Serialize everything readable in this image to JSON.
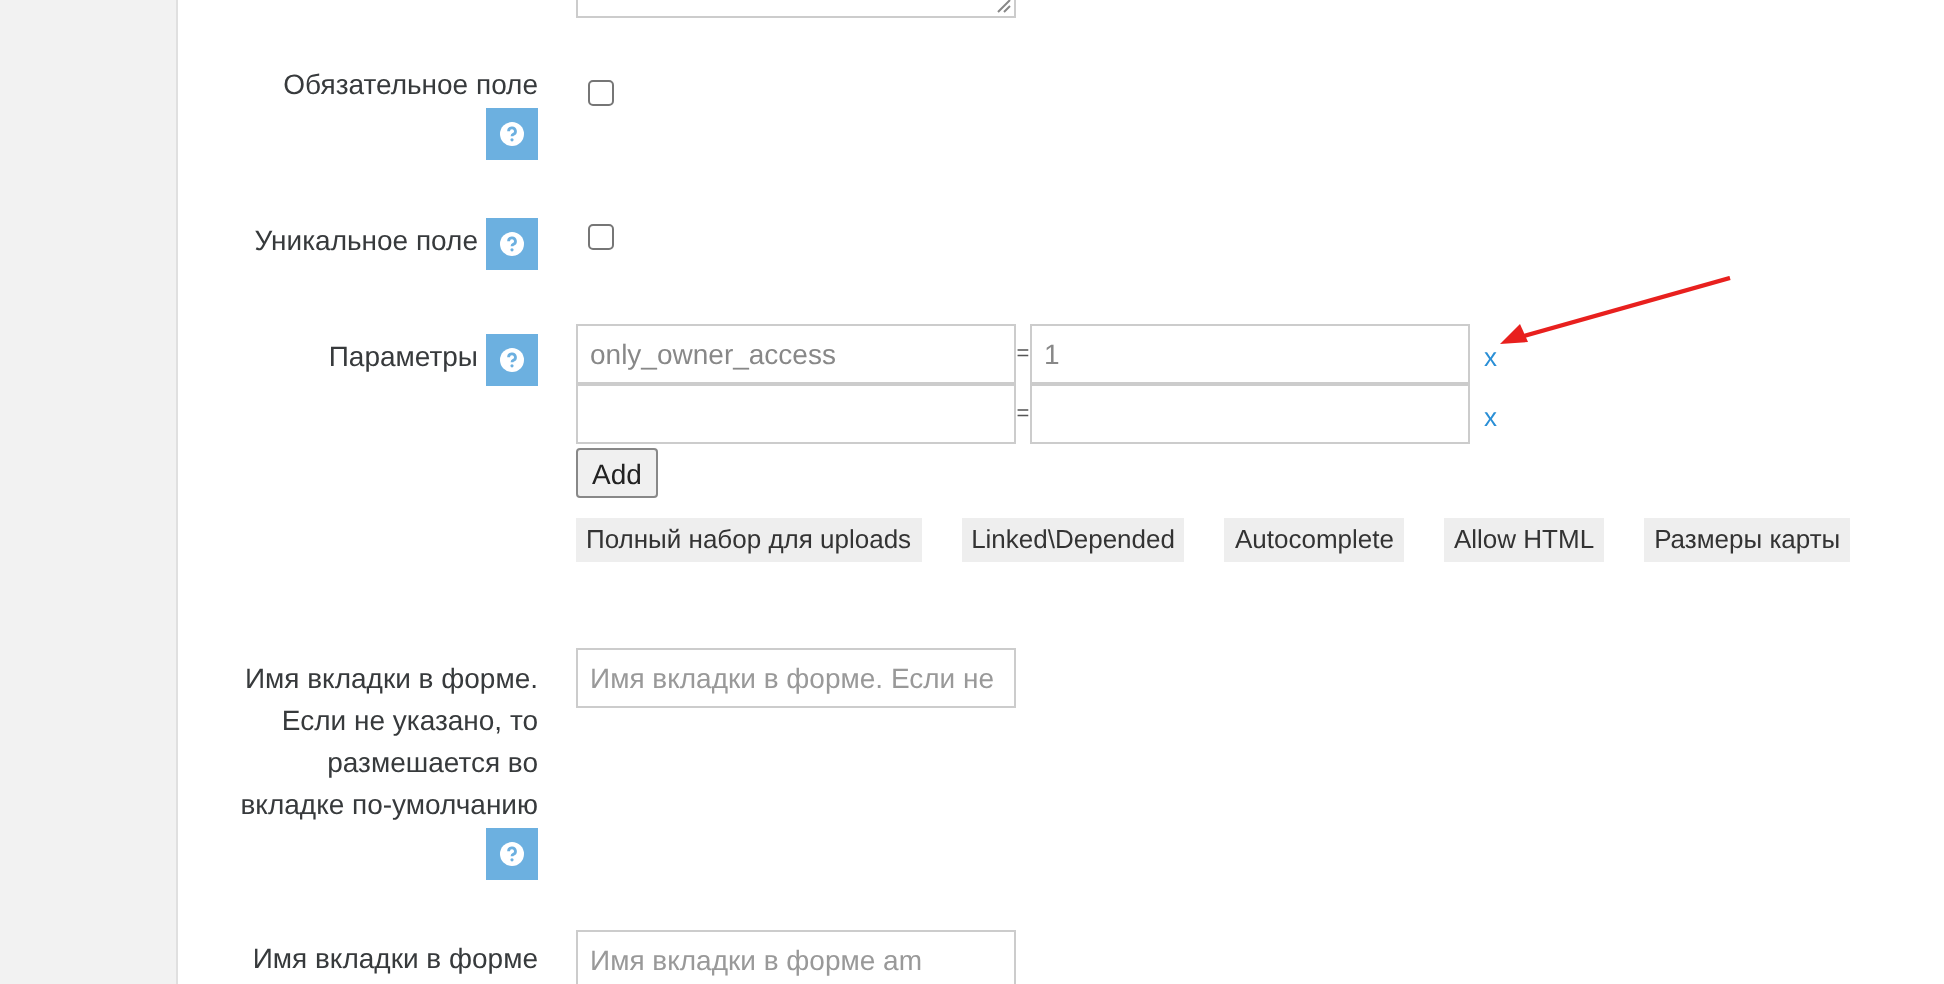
{
  "fields": [
    {
      "kind": "textarea"
    },
    {
      "kind": "checkbox",
      "label": "Обязательное поле",
      "help": true,
      "checked": false
    },
    {
      "kind": "checkbox",
      "label": "Уникальное поле",
      "help": true,
      "checked": false
    },
    {
      "kind": "params",
      "label": "Параметры",
      "help": true,
      "rows": [
        {
          "key": "only_owner_access",
          "sep": "=",
          "value": "1",
          "remove": "x"
        },
        {
          "sep": "=",
          "remove": "x"
        }
      ],
      "add_button": "Add",
      "presets": [
        "Полный набор для uploads",
        "Linked\\Depended",
        "Autocomplete",
        "Allow HTML",
        "Размеры карты"
      ]
    },
    {
      "kind": "text",
      "label": "Имя вкладки в форме. Если не указано, то размешается во вкладке по-умолчанию",
      "help": true,
      "placeholder": "Имя вкладки в форме. Если не"
    },
    {
      "kind": "text",
      "label": "Имя вкладки в форме",
      "help": false,
      "placeholder": "Имя вкладки в форме am"
    }
  ],
  "annotation": {
    "kind": "arrow"
  }
}
